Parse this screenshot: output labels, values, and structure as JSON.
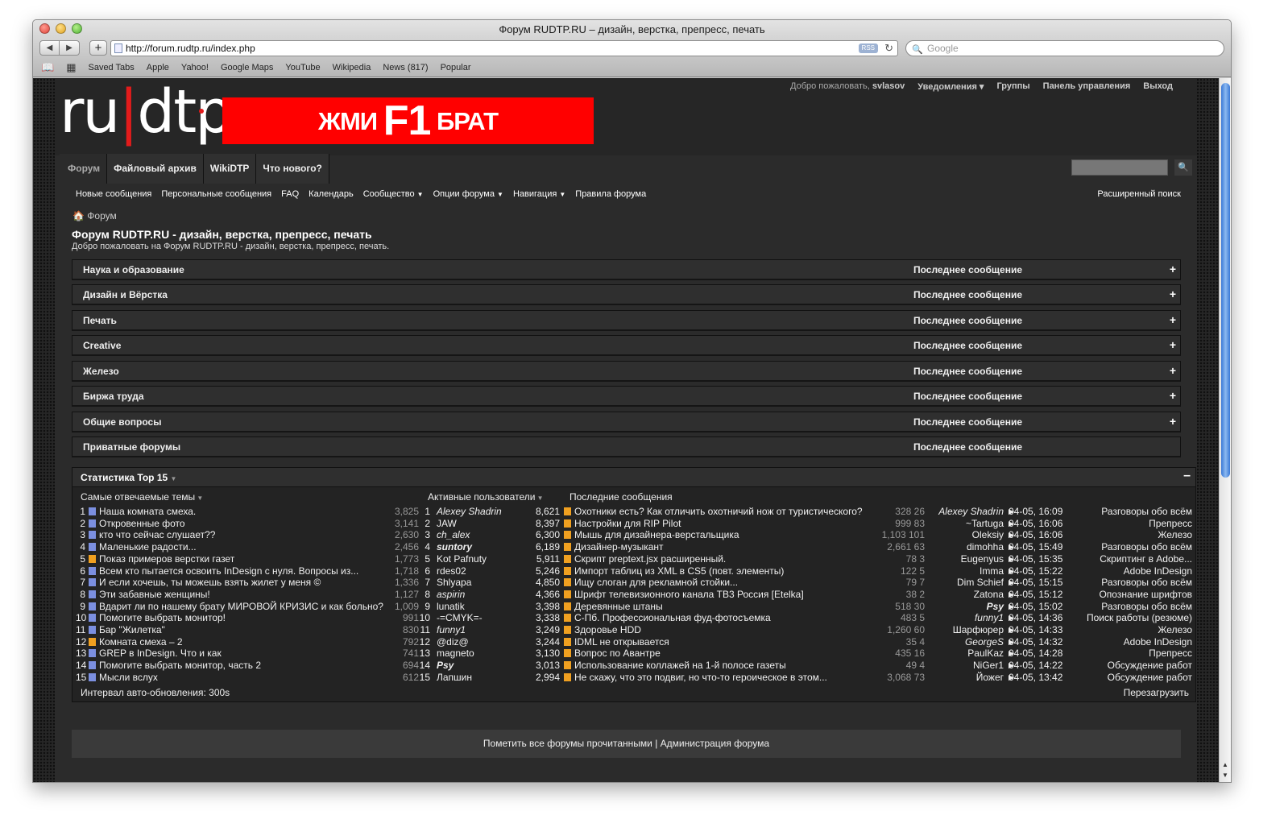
{
  "window": {
    "title": "Форум RUDTP.RU – дизайн, верстка, препресс, печать"
  },
  "toolbar": {
    "url": "http://forum.rudtp.ru/index.php",
    "rss": "RSS",
    "search_placeholder": "Google"
  },
  "bookmarks": [
    "Saved Tabs",
    "Apple",
    "Yahoo!",
    "Google Maps",
    "YouTube",
    "Wikipedia",
    "News (817)",
    "Popular"
  ],
  "header": {
    "logo_left": "ru",
    "logo_right": "dtp",
    "banner": {
      "pre": "ЖМИ",
      "key": "F1",
      "post": "БРАТ"
    },
    "welcome": "Добро пожаловать,",
    "username": "svlasov",
    "notifications": "Уведомления",
    "groups": "Группы",
    "control_panel": "Панель управления",
    "logout": "Выход"
  },
  "tabs": [
    "Форум",
    "Файловый архив",
    "WikiDTP",
    "Что нового?"
  ],
  "subnav": [
    "Новые сообщения",
    "Персональные сообщения",
    "FAQ",
    "Календарь",
    "Сообщество",
    "Опции форума",
    "Навигация",
    "Правила форума"
  ],
  "advanced_search": "Расширенный поиск",
  "breadcrumb": "Форум",
  "page_title": "Форум RUDTP.RU - дизайн, верстка, препресс, печать",
  "page_subtitle": "Добро пожаловать на Форум RUDTP.RU - дизайн, верстка, препресс, печать.",
  "categories": [
    {
      "name": "Наука и образование",
      "last": "Последнее сообщение",
      "toggle": "+"
    },
    {
      "name": "Дизайн и Вёрстка",
      "last": "Последнее сообщение",
      "toggle": "+"
    },
    {
      "name": "Печать",
      "last": "Последнее сообщение",
      "toggle": "+"
    },
    {
      "name": "Creative",
      "last": "Последнее сообщение",
      "toggle": "+"
    },
    {
      "name": "Железо",
      "last": "Последнее сообщение",
      "toggle": "+"
    },
    {
      "name": "Биржа труда",
      "last": "Последнее сообщение",
      "toggle": "+"
    },
    {
      "name": "Общие вопросы",
      "last": "Последнее сообщение",
      "toggle": "+"
    },
    {
      "name": "Приватные форумы",
      "last": "Последнее сообщение",
      "toggle": ""
    }
  ],
  "stats": {
    "title": "Статистика Top 15",
    "collapse": "–",
    "col_topics": "Самые отвечаемые темы",
    "col_users": "Активные пользователи",
    "col_recent": "Последние сообщения",
    "topics": [
      {
        "n": "1",
        "t": "Наша комната смеха.",
        "v": "3,825",
        "c": "#7b8fe0"
      },
      {
        "n": "2",
        "t": "Откровенные фото",
        "v": "3,141",
        "c": "#7b8fe0"
      },
      {
        "n": "3",
        "t": "кто что сейчас слушает??",
        "v": "2,630",
        "c": "#7b8fe0"
      },
      {
        "n": "4",
        "t": "Маленькие радости...",
        "v": "2,456",
        "c": "#7b8fe0"
      },
      {
        "n": "5",
        "t": "Показ примеров верстки газет",
        "v": "1,773",
        "c": "#f0a020"
      },
      {
        "n": "6",
        "t": "Всем кто пытается освоить InDesign с нуля. Вопросы из...",
        "v": "1,718",
        "c": "#7b8fe0"
      },
      {
        "n": "7",
        "t": "И если хочешь, ты можешь взять жилет у меня ©",
        "v": "1,336",
        "c": "#7b8fe0"
      },
      {
        "n": "8",
        "t": "Эти забавные женщины!",
        "v": "1,127",
        "c": "#7b8fe0"
      },
      {
        "n": "9",
        "t": "Вдарит ли по нашему брату МИРОВОЙ КРИЗИС и как больно?",
        "v": "1,009",
        "c": "#7b8fe0"
      },
      {
        "n": "10",
        "t": "Помогите выбрать монитор!",
        "v": "991",
        "c": "#7b8fe0"
      },
      {
        "n": "11",
        "t": "Бар \"Жилетка\"",
        "v": "830",
        "c": "#7b8fe0"
      },
      {
        "n": "12",
        "t": "Комната смеха – 2",
        "v": "792",
        "c": "#f0a020"
      },
      {
        "n": "13",
        "t": "GREP в InDesign. Что и как",
        "v": "741",
        "c": "#7b8fe0"
      },
      {
        "n": "14",
        "t": "Помогите выбрать монитор, часть 2",
        "v": "694",
        "c": "#7b8fe0"
      },
      {
        "n": "15",
        "t": "Мысли вслух",
        "v": "612",
        "c": "#7b8fe0"
      }
    ],
    "users": [
      {
        "n": "1",
        "u": "Alexey Shadrin",
        "v": "8,621",
        "s": "it"
      },
      {
        "n": "2",
        "u": "JAW",
        "v": "8,397",
        "s": ""
      },
      {
        "n": "3",
        "u": "ch_alex",
        "v": "6,300",
        "s": "it"
      },
      {
        "n": "4",
        "u": "suntory",
        "v": "6,189",
        "s": "it bd"
      },
      {
        "n": "5",
        "u": "Kot Pafnuty",
        "v": "5,911",
        "s": ""
      },
      {
        "n": "6",
        "u": "rdes02",
        "v": "5,246",
        "s": ""
      },
      {
        "n": "7",
        "u": "Shlyapa",
        "v": "4,850",
        "s": ""
      },
      {
        "n": "8",
        "u": "aspirin",
        "v": "4,366",
        "s": "it"
      },
      {
        "n": "9",
        "u": "lunatik",
        "v": "3,398",
        "s": ""
      },
      {
        "n": "10",
        "u": "-=CMYK=-",
        "v": "3,338",
        "s": ""
      },
      {
        "n": "11",
        "u": "funny1",
        "v": "3,249",
        "s": "it"
      },
      {
        "n": "12",
        "u": "@diz@",
        "v": "3,244",
        "s": ""
      },
      {
        "n": "13",
        "u": "magneto",
        "v": "3,130",
        "s": ""
      },
      {
        "n": "14",
        "u": "Psy",
        "v": "3,013",
        "s": "it bd"
      },
      {
        "n": "15",
        "u": "Лапшин",
        "v": "2,994",
        "s": ""
      }
    ],
    "recent": [
      {
        "t": "Охотники есть? Как отличить охотничий нож от туристического?",
        "stats": "328 26",
        "u": "Alexey Shadrin",
        "us": "it",
        "d": "04-05, 16:09",
        "f": "Разговоры обо всём"
      },
      {
        "t": "Настройки для RIP Pilot",
        "stats": "999 83",
        "u": "~Tartuga",
        "us": "",
        "d": "04-05, 16:06",
        "f": "Препресс"
      },
      {
        "t": "Мышь для дизайнера-верстальщика",
        "stats": "1,103 101",
        "u": "Oleksiy",
        "us": "",
        "d": "04-05, 16:06",
        "f": "Железо"
      },
      {
        "t": "Дизайнер-музыкант",
        "stats": "2,661 63",
        "u": "dimohha",
        "us": "",
        "d": "04-05, 15:49",
        "f": "Разговоры обо всём"
      },
      {
        "t": "Скрипт preptext.jsx расширенный.",
        "stats": "78 3",
        "u": "Eugenyus",
        "us": "",
        "d": "04-05, 15:35",
        "f": "Скриптинг в Adobe..."
      },
      {
        "t": "Импорт таблиц из XML в CS5 (повт. элементы)",
        "stats": "122 5",
        "u": "Imma",
        "us": "",
        "d": "04-05, 15:22",
        "f": "Adobe InDesign"
      },
      {
        "t": "Ищу слоган для рекламной стойки...",
        "stats": "79 7",
        "u": "Dim Schief",
        "us": "",
        "d": "04-05, 15:15",
        "f": "Разговоры обо всём"
      },
      {
        "t": "Шрифт телевизионного канала ТВ3 Россия [Etelka]",
        "stats": "38 2",
        "u": "Zatona",
        "us": "",
        "d": "04-05, 15:12",
        "f": "Опознание шрифтов"
      },
      {
        "t": "Деревянные штаны",
        "stats": "518 30",
        "u": "Psy",
        "us": "it bd",
        "d": "04-05, 15:02",
        "f": "Разговоры обо всём"
      },
      {
        "t": "С-Пб. Профессиональная фуд-фотосъемка",
        "stats": "483 5",
        "u": "funny1",
        "us": "it",
        "d": "04-05, 14:36",
        "f": "Поиск работы (резюме)"
      },
      {
        "t": "Здоровье HDD",
        "stats": "1,260 60",
        "u": "Шарфюрер",
        "us": "",
        "d": "04-05, 14:33",
        "f": "Железо"
      },
      {
        "t": "IDML не открывается",
        "stats": "35 4",
        "u": "GeorgeS",
        "us": "it",
        "d": "04-05, 14:32",
        "f": "Adobe InDesign"
      },
      {
        "t": "Вопрос по Авантре",
        "stats": "435 16",
        "u": "PaulKaz",
        "us": "",
        "d": "04-05, 14:28",
        "f": "Препресс"
      },
      {
        "t": "Использование коллажей на 1-й полосе газеты",
        "stats": "49 4",
        "u": "NiGer1",
        "us": "",
        "d": "04-05, 14:22",
        "f": "Обсуждение работ"
      },
      {
        "t": "Не скажу, что это подвиг, но что-то героическое в этом...",
        "stats": "3,068 73",
        "u": "Йожег",
        "us": "",
        "d": "04-05, 13:42",
        "f": "Обсуждение работ"
      }
    ],
    "interval": "Интервал авто-обновления: 300s",
    "reload": "Перезагрузить"
  },
  "footer": {
    "mark_read": "Пометить все форумы прочитанными",
    "sep": "|",
    "admin": "Администрация форума"
  }
}
